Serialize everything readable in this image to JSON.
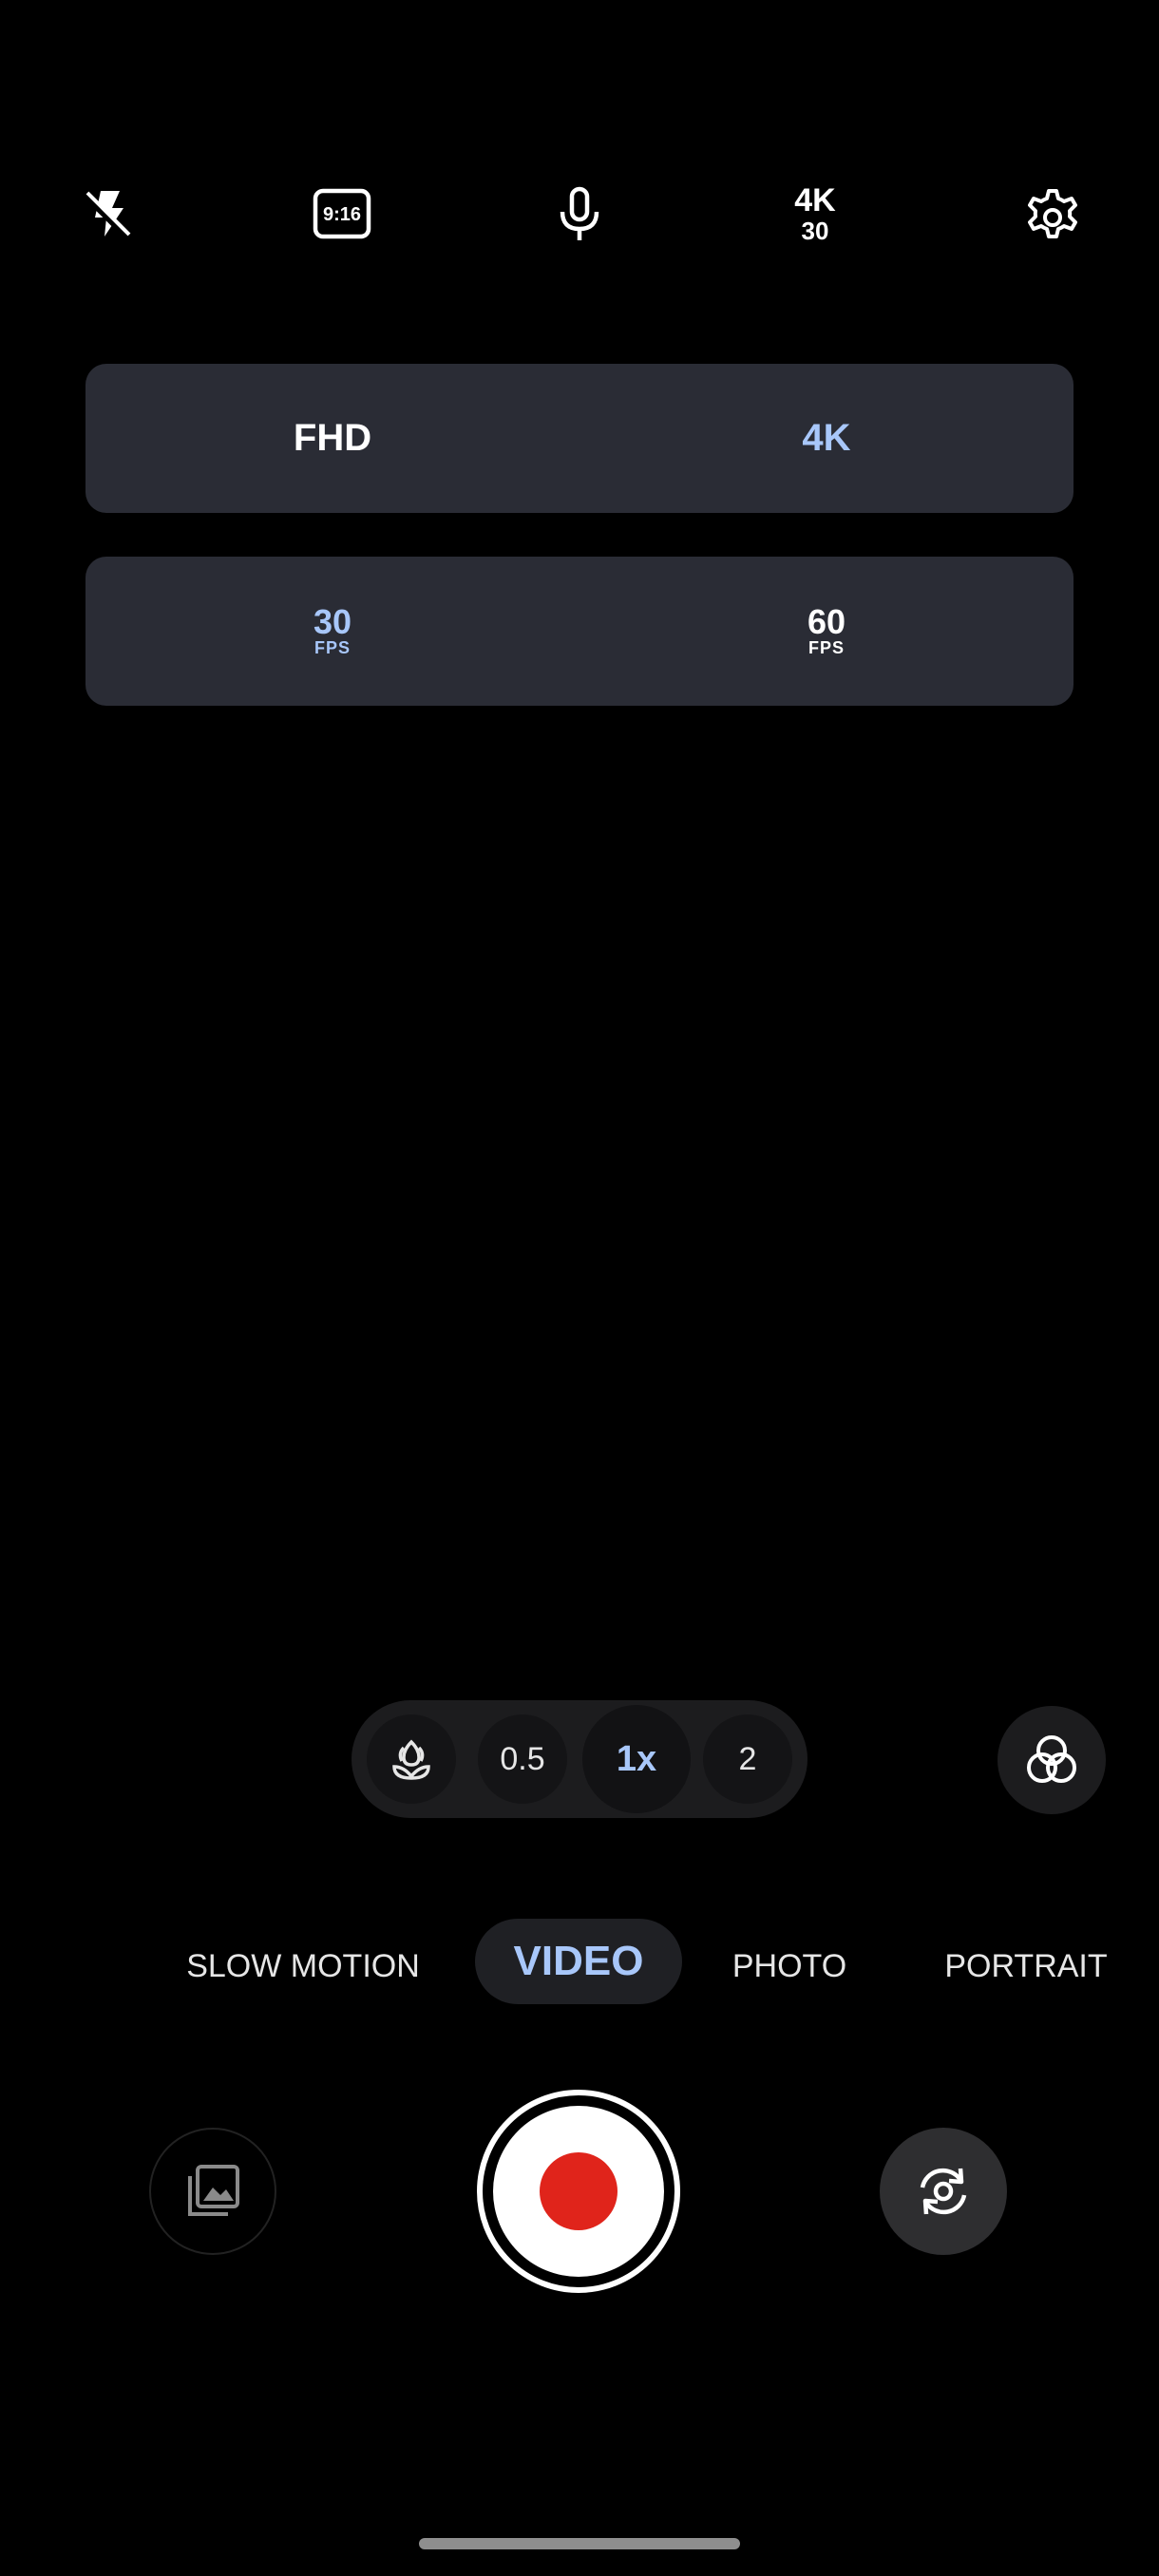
{
  "toolbar": {
    "flash_icon": "flash-off-icon",
    "aspect_ratio": "9:16",
    "mic_icon": "microphone-icon",
    "resolution_badge_top": "4K",
    "resolution_badge_bottom": "30",
    "settings_icon": "gear-icon"
  },
  "resolution_selector": {
    "options": [
      "FHD",
      "4K"
    ],
    "selected": "4K"
  },
  "fps_selector": {
    "options": [
      {
        "value": "30",
        "unit": "FPS"
      },
      {
        "value": "60",
        "unit": "FPS"
      }
    ],
    "selected": "30"
  },
  "zoom": {
    "macro_icon": "macro-flower-icon",
    "levels": [
      "0.5",
      "1x",
      "2"
    ],
    "selected": "1x"
  },
  "filter_icon": "filters-icon",
  "modes": {
    "items": [
      "SLOW MOTION",
      "VIDEO",
      "PHOTO",
      "PORTRAIT"
    ],
    "selected": "VIDEO"
  },
  "controls": {
    "gallery_icon": "gallery-icon",
    "shutter_icon": "record-icon",
    "flip_icon": "flip-camera-icon"
  },
  "colors": {
    "accent": "#a8c7fa",
    "record": "#e0241b",
    "panel": "#2a2c35"
  }
}
